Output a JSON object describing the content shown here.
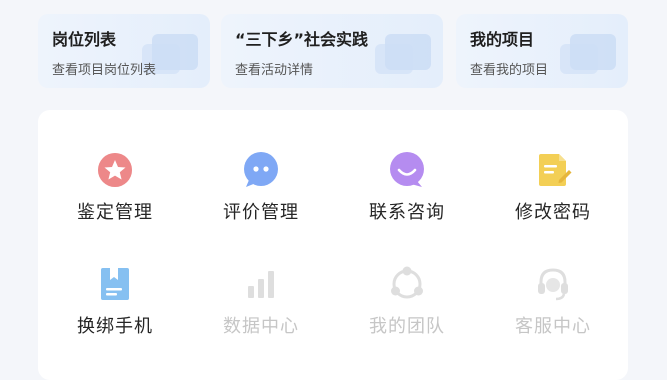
{
  "cards": [
    {
      "title": "岗位列表",
      "subtitle": "查看项目岗位列表"
    },
    {
      "title": "“三下乡”社会实践",
      "subtitle": "查看活动详情"
    },
    {
      "title": "我的项目",
      "subtitle": "查看我的项目"
    }
  ],
  "menu": [
    {
      "label": "鉴定管理",
      "icon": "star-badge-icon",
      "enabled": true
    },
    {
      "label": "评价管理",
      "icon": "chat-bubble-icon",
      "enabled": true
    },
    {
      "label": "联系咨询",
      "icon": "smile-bubble-icon",
      "enabled": true
    },
    {
      "label": "修改密码",
      "icon": "edit-document-icon",
      "enabled": true
    },
    {
      "label": "换绑手机",
      "icon": "bookmark-document-icon",
      "enabled": true
    },
    {
      "label": "数据中心",
      "icon": "bar-chart-icon",
      "enabled": false
    },
    {
      "label": "我的团队",
      "icon": "team-cycle-icon",
      "enabled": false
    },
    {
      "label": "客服中心",
      "icon": "headset-icon",
      "enabled": false
    }
  ],
  "colors": {
    "star_badge": "#e9797b",
    "chat_bubble": "#7fa8f5",
    "smile_bubble": "#b58cf0",
    "edit_document": "#f3cf55",
    "bookmark_document": "#74b7ef",
    "disabled": "#dedede"
  }
}
